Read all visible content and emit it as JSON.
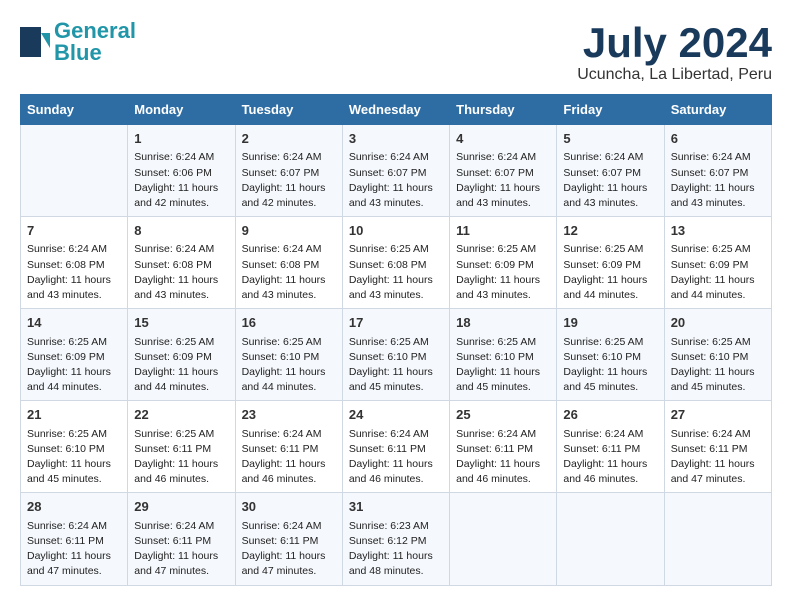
{
  "header": {
    "logo_general": "General",
    "logo_blue": "Blue",
    "main_title": "July 2024",
    "subtitle": "Ucuncha, La Libertad, Peru"
  },
  "weekdays": [
    "Sunday",
    "Monday",
    "Tuesday",
    "Wednesday",
    "Thursday",
    "Friday",
    "Saturday"
  ],
  "weeks": [
    [
      {
        "day": "",
        "info": ""
      },
      {
        "day": "1",
        "info": "Sunrise: 6:24 AM\nSunset: 6:06 PM\nDaylight: 11 hours\nand 42 minutes."
      },
      {
        "day": "2",
        "info": "Sunrise: 6:24 AM\nSunset: 6:07 PM\nDaylight: 11 hours\nand 42 minutes."
      },
      {
        "day": "3",
        "info": "Sunrise: 6:24 AM\nSunset: 6:07 PM\nDaylight: 11 hours\nand 43 minutes."
      },
      {
        "day": "4",
        "info": "Sunrise: 6:24 AM\nSunset: 6:07 PM\nDaylight: 11 hours\nand 43 minutes."
      },
      {
        "day": "5",
        "info": "Sunrise: 6:24 AM\nSunset: 6:07 PM\nDaylight: 11 hours\nand 43 minutes."
      },
      {
        "day": "6",
        "info": "Sunrise: 6:24 AM\nSunset: 6:07 PM\nDaylight: 11 hours\nand 43 minutes."
      }
    ],
    [
      {
        "day": "7",
        "info": "Sunrise: 6:24 AM\nSunset: 6:08 PM\nDaylight: 11 hours\nand 43 minutes."
      },
      {
        "day": "8",
        "info": "Sunrise: 6:24 AM\nSunset: 6:08 PM\nDaylight: 11 hours\nand 43 minutes."
      },
      {
        "day": "9",
        "info": "Sunrise: 6:24 AM\nSunset: 6:08 PM\nDaylight: 11 hours\nand 43 minutes."
      },
      {
        "day": "10",
        "info": "Sunrise: 6:25 AM\nSunset: 6:08 PM\nDaylight: 11 hours\nand 43 minutes."
      },
      {
        "day": "11",
        "info": "Sunrise: 6:25 AM\nSunset: 6:09 PM\nDaylight: 11 hours\nand 43 minutes."
      },
      {
        "day": "12",
        "info": "Sunrise: 6:25 AM\nSunset: 6:09 PM\nDaylight: 11 hours\nand 44 minutes."
      },
      {
        "day": "13",
        "info": "Sunrise: 6:25 AM\nSunset: 6:09 PM\nDaylight: 11 hours\nand 44 minutes."
      }
    ],
    [
      {
        "day": "14",
        "info": "Sunrise: 6:25 AM\nSunset: 6:09 PM\nDaylight: 11 hours\nand 44 minutes."
      },
      {
        "day": "15",
        "info": "Sunrise: 6:25 AM\nSunset: 6:09 PM\nDaylight: 11 hours\nand 44 minutes."
      },
      {
        "day": "16",
        "info": "Sunrise: 6:25 AM\nSunset: 6:10 PM\nDaylight: 11 hours\nand 44 minutes."
      },
      {
        "day": "17",
        "info": "Sunrise: 6:25 AM\nSunset: 6:10 PM\nDaylight: 11 hours\nand 45 minutes."
      },
      {
        "day": "18",
        "info": "Sunrise: 6:25 AM\nSunset: 6:10 PM\nDaylight: 11 hours\nand 45 minutes."
      },
      {
        "day": "19",
        "info": "Sunrise: 6:25 AM\nSunset: 6:10 PM\nDaylight: 11 hours\nand 45 minutes."
      },
      {
        "day": "20",
        "info": "Sunrise: 6:25 AM\nSunset: 6:10 PM\nDaylight: 11 hours\nand 45 minutes."
      }
    ],
    [
      {
        "day": "21",
        "info": "Sunrise: 6:25 AM\nSunset: 6:10 PM\nDaylight: 11 hours\nand 45 minutes."
      },
      {
        "day": "22",
        "info": "Sunrise: 6:25 AM\nSunset: 6:11 PM\nDaylight: 11 hours\nand 46 minutes."
      },
      {
        "day": "23",
        "info": "Sunrise: 6:24 AM\nSunset: 6:11 PM\nDaylight: 11 hours\nand 46 minutes."
      },
      {
        "day": "24",
        "info": "Sunrise: 6:24 AM\nSunset: 6:11 PM\nDaylight: 11 hours\nand 46 minutes."
      },
      {
        "day": "25",
        "info": "Sunrise: 6:24 AM\nSunset: 6:11 PM\nDaylight: 11 hours\nand 46 minutes."
      },
      {
        "day": "26",
        "info": "Sunrise: 6:24 AM\nSunset: 6:11 PM\nDaylight: 11 hours\nand 46 minutes."
      },
      {
        "day": "27",
        "info": "Sunrise: 6:24 AM\nSunset: 6:11 PM\nDaylight: 11 hours\nand 47 minutes."
      }
    ],
    [
      {
        "day": "28",
        "info": "Sunrise: 6:24 AM\nSunset: 6:11 PM\nDaylight: 11 hours\nand 47 minutes."
      },
      {
        "day": "29",
        "info": "Sunrise: 6:24 AM\nSunset: 6:11 PM\nDaylight: 11 hours\nand 47 minutes."
      },
      {
        "day": "30",
        "info": "Sunrise: 6:24 AM\nSunset: 6:11 PM\nDaylight: 11 hours\nand 47 minutes."
      },
      {
        "day": "31",
        "info": "Sunrise: 6:23 AM\nSunset: 6:12 PM\nDaylight: 11 hours\nand 48 minutes."
      },
      {
        "day": "",
        "info": ""
      },
      {
        "day": "",
        "info": ""
      },
      {
        "day": "",
        "info": ""
      }
    ]
  ]
}
